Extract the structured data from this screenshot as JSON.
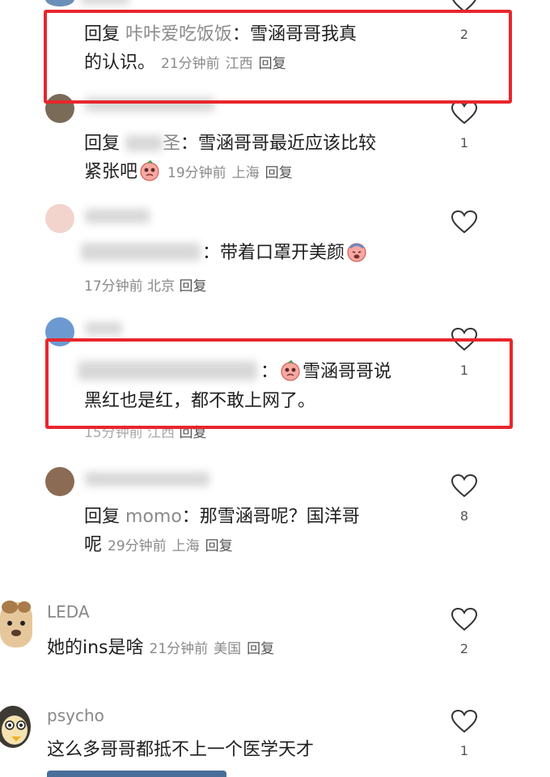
{
  "c1": {
    "reply_prefix": "回复",
    "reply_to": "咔咔爱吃饭饭",
    "text_a": "：雪涵哥哥我真",
    "text_b": "的认识。",
    "time": "21分钟前",
    "location": "江西",
    "reply_label": "回复",
    "likes": "2"
  },
  "c2": {
    "reply_prefix": "回复",
    "name_tail": "圣",
    "text_a": "：雪涵哥哥最近应该比较",
    "text_b": "紧张吧",
    "time": "19分钟前",
    "location": "上海",
    "reply_label": "回复",
    "likes": "1"
  },
  "c3": {
    "text_a": "：带着口罩开美颜",
    "time": "17分钟前",
    "location": "北京",
    "reply_label": "回复"
  },
  "c4": {
    "text_a": "：",
    "text_emoji_after": "雪涵哥哥说",
    "text_b": "黑红也是红，都不敢上网了。",
    "time": "15分钟前",
    "location": "江西",
    "reply_label": "回复",
    "likes": "1"
  },
  "c5": {
    "reply_prefix": "回复",
    "reply_to": "momo",
    "text_a": "：那雪涵哥呢？国洋哥",
    "text_b": "呢",
    "time": "29分钟前",
    "location": "上海",
    "reply_label": "回复",
    "likes": "8"
  },
  "c6": {
    "username": "LEDA",
    "text": "她的ins是啥",
    "time": "21分钟前",
    "location": "美国",
    "reply_label": "回复",
    "likes": "2"
  },
  "c7": {
    "username": "psycho",
    "text": "这么多哥哥都抵不上一个医学天才",
    "likes": "1"
  },
  "colors": {
    "highlight": "#e8262c",
    "meta": "#8a8a8a"
  },
  "icons": [
    "heart-outline-icon",
    "sweat-face-emoji",
    "pleading-face-emoji",
    "dog-avatar",
    "cartoon-avatar"
  ]
}
